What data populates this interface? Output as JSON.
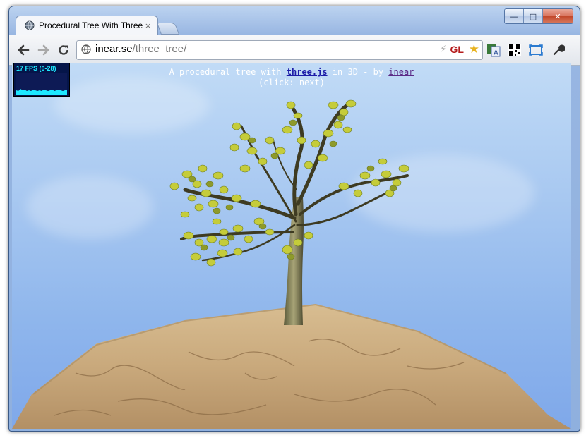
{
  "window": {
    "minimize_icon": "minimize-icon",
    "maximize_icon": "maximize-icon",
    "close_icon": "close-icon"
  },
  "tab": {
    "title": "Procedural Tree With Three",
    "close": "×"
  },
  "address": {
    "domain": "inear.se",
    "path": "/three_tree/",
    "gl_badge": "GL"
  },
  "page": {
    "caption_prefix": "A procedural tree with",
    "link_threejs": "three.js",
    "caption_mid": "in 3D - by",
    "link_author": "inear",
    "caption_line2": "(click: next)"
  },
  "fps": {
    "label": "17 FPS (0-28)"
  },
  "colors": {
    "sky_top": "#c1dbf6",
    "sky_bottom": "#7fa8ea",
    "leaf": "#b7c43a",
    "rock": "#c9a97c"
  }
}
